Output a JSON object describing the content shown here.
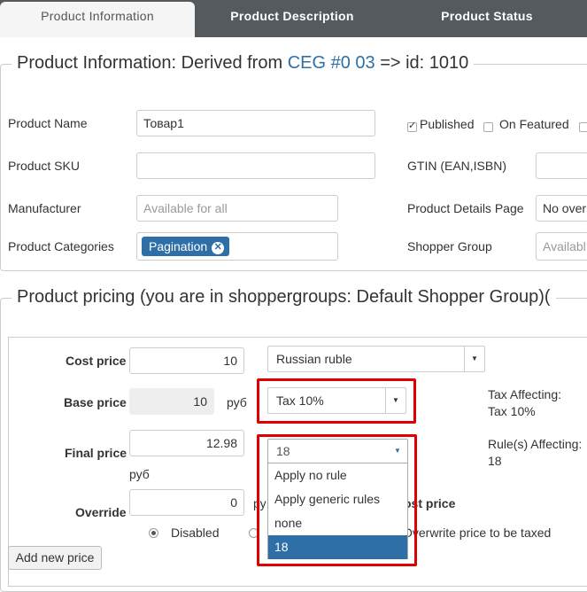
{
  "tabs": [
    "Product Information",
    "Product Description",
    "Product Status"
  ],
  "info": {
    "legend_prefix": "Product Information: Derived from ",
    "legend_link": "CEG #0 03",
    "legend_suffix": " => id: 1010",
    "product_name_label": "Product Name",
    "product_name_value": "Товар1",
    "published_label": "Published",
    "on_featured_label": "On Featured",
    "product_sku_label": "Product SKU",
    "gtin_label": "GTIN (EAN,ISBN)",
    "manufacturer_label": "Manufacturer",
    "manufacturer_placeholder": "Available for all",
    "details_page_label": "Product Details Page",
    "details_page_value": "No over",
    "categories_label": "Product Categories",
    "category_tag": "Pagination",
    "shopper_group_label": "Shopper Group",
    "shopper_group_placeholder": "Availabl"
  },
  "pricing": {
    "legend": "Product pricing (you are in shoppergroups: Default Shopper Group)(",
    "cost_price_label": "Cost price",
    "cost_price_value": "10",
    "currency": "Russian ruble",
    "base_price_label": "Base price",
    "base_price_value": "10",
    "currency_symbol": "руб",
    "tax_select": "Tax 10%",
    "tax_affecting_label": "Tax Affecting:",
    "tax_affecting_value": "Tax 10%",
    "final_price_label": "Final price",
    "final_price_value": "12.98",
    "final_currency_symbol": "руб",
    "rule_select": "18",
    "rules_affecting_label": "Rule(s) Affecting:",
    "rules_affecting_value": "18",
    "dropdown_options": [
      "Apply no rule",
      "Apply generic rules",
      "none",
      "18"
    ],
    "override_label": "Override",
    "override_value": "0",
    "override_currency_partial": "ру",
    "cost_price_partial": "ost price",
    "disabled_label": "Disabled",
    "overwrite_label": "Overwrite price to be taxed",
    "add_price_button": "Add new price"
  },
  "colors": {
    "accent": "#2f6fa7",
    "highlight": "#e00000",
    "tabbar": "#555a5e"
  }
}
